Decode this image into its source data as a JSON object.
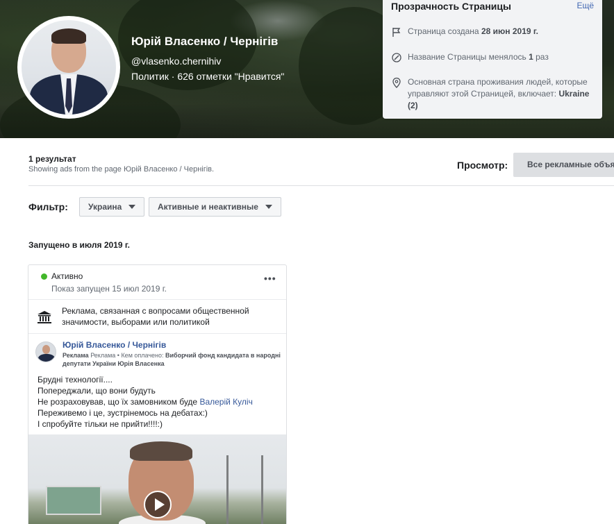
{
  "header": {
    "page_name": "Юрій Власенко / Чернігів",
    "handle": "@vlasenko.chernihiv",
    "meta": "Политик · 626 отметки \"Нравится\""
  },
  "transparency": {
    "title": "Прозрачность Страницы",
    "more_link": "Ещё",
    "created_prefix": "Страница создана ",
    "created_date": "28 июн 2019 г.",
    "renamed_prefix": "Название Страницы менялось ",
    "renamed_count": "1",
    "renamed_suffix": " раз",
    "country_text": "Основная страна проживания людей, которые управляют этой Страницей, включает: ",
    "country_value": "Ukraine (2)"
  },
  "results": {
    "count_label": "1 результат",
    "subtitle": "Showing ads from the page Юрій Власенко / Чернігів.",
    "view_label": "Просмотр:",
    "view_button": "Все рекламные объявления"
  },
  "filters": {
    "label": "Фильтр:",
    "country": "Украина",
    "status": "Активные и неактивные"
  },
  "section_title": "Запущено в июля 2019 г.",
  "ad": {
    "status": "Активно",
    "shown_since": "Показ запущен 15 июл 2019 г.",
    "category": "Реклама, связанная с вопросами общественной значимости, выборами или политикой",
    "post_author": "Юрій Власенко / Чернігів",
    "sponsored_prefix": "Реклама • Кем оплачено: ",
    "paid_by": "Виборчий фонд кандидата в народні депутати України Юрія Власенка",
    "body_lines": [
      "Брудні технології....",
      "Попереджали, що вони будуть",
      "Не розраховував, що їх замовником буде ",
      "Переживемо і це, зустрінемось на дебатах:)",
      "І спробуйте тільки не прийти!!!!:)"
    ],
    "mention": "Валерій Куліч"
  },
  "colors": {
    "link": "#365899",
    "active_dot": "#42b72a",
    "card_bg": "#f2f3f5"
  }
}
